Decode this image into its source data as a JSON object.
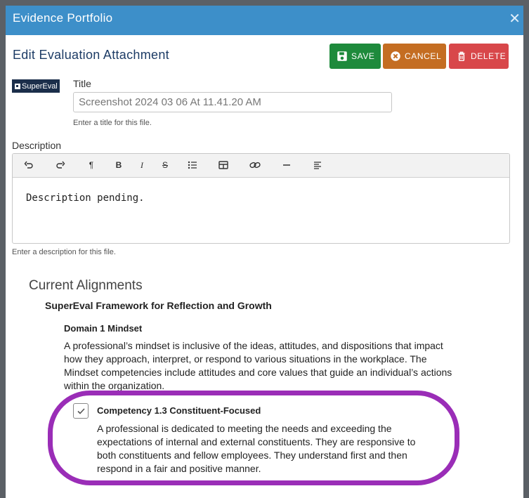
{
  "window": {
    "title": "Evidence Portfolio"
  },
  "header": {
    "title": "Edit Evaluation Attachment"
  },
  "buttons": {
    "save": "SAVE",
    "cancel": "CANCEL",
    "delete": "DELETE"
  },
  "logo": {
    "text": "SuperEval"
  },
  "title_field": {
    "label": "Title",
    "value": "Screenshot 2024 03 06 At 11.41.20 AM",
    "help": "Enter a title for this file."
  },
  "description": {
    "label": "Description",
    "content": "Description pending.",
    "help": "Enter a description for this file.",
    "toolbar": [
      "undo-icon",
      "redo-icon",
      "paragraph-icon",
      "bold-icon",
      "italic-icon",
      "strikethrough-icon",
      "bullet-list-icon",
      "table-icon",
      "link-icon",
      "horizontal-rule-icon",
      "align-left-icon"
    ]
  },
  "alignments": {
    "heading": "Current Alignments",
    "framework": "SuperEval Framework for Reflection and Growth",
    "domain": {
      "title": "Domain 1 Mindset",
      "text": "A professional’s mindset is inclusive of the ideas, attitudes, and dispositions that impact how they approach, interpret, or respond to various situations in the workplace. The Mindset competencies include attitudes and core values that guide an individual’s actions within the organization."
    },
    "competency": {
      "title": "Competency 1.3 Constituent-Focused",
      "checked": true,
      "text": "A professional is dedicated to meeting the needs and exceeding the expectations of internal and external constituents. They are responsive to both constituents and fellow employees. They understand first and then respond in a fair and positive manner."
    }
  },
  "colors": {
    "header": "#3d8fc9",
    "save": "#1e8a3c",
    "cancel": "#c46d22",
    "delete": "#d8474a",
    "highlight": "#9a2db7"
  }
}
